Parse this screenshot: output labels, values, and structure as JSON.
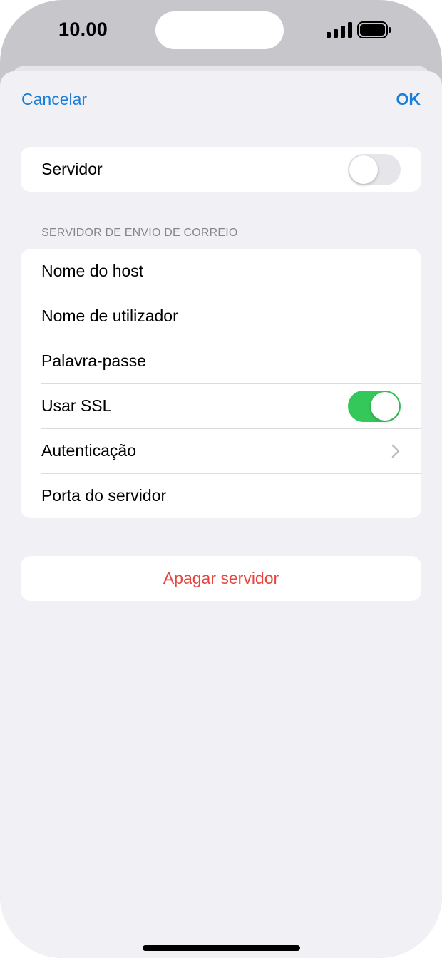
{
  "status_bar": {
    "time": "10.00"
  },
  "nav": {
    "cancel_label": "Cancelar",
    "ok_label": "OK"
  },
  "server_toggle": {
    "label": "Servidor",
    "on": false
  },
  "outgoing_section": {
    "header": "SERVIDOR DE ENVIO DE CORREIO",
    "rows": [
      {
        "label": "Nome do host"
      },
      {
        "label": "Nome de utilizador"
      },
      {
        "label": "Palavra-passe"
      },
      {
        "label": "Usar SSL",
        "toggle_on": true
      },
      {
        "label": "Autenticação"
      },
      {
        "label": "Porta do servidor"
      }
    ]
  },
  "delete": {
    "label": "Apagar servidor"
  },
  "colors": {
    "accent": "#1a7ed8",
    "destructive": "#e5463e",
    "toggle_on": "#34c759",
    "background": "#f1f1f5"
  },
  "icons": {
    "signal": "cellular-signal-icon",
    "battery": "battery-icon",
    "chevron": "chevron-right-icon"
  }
}
